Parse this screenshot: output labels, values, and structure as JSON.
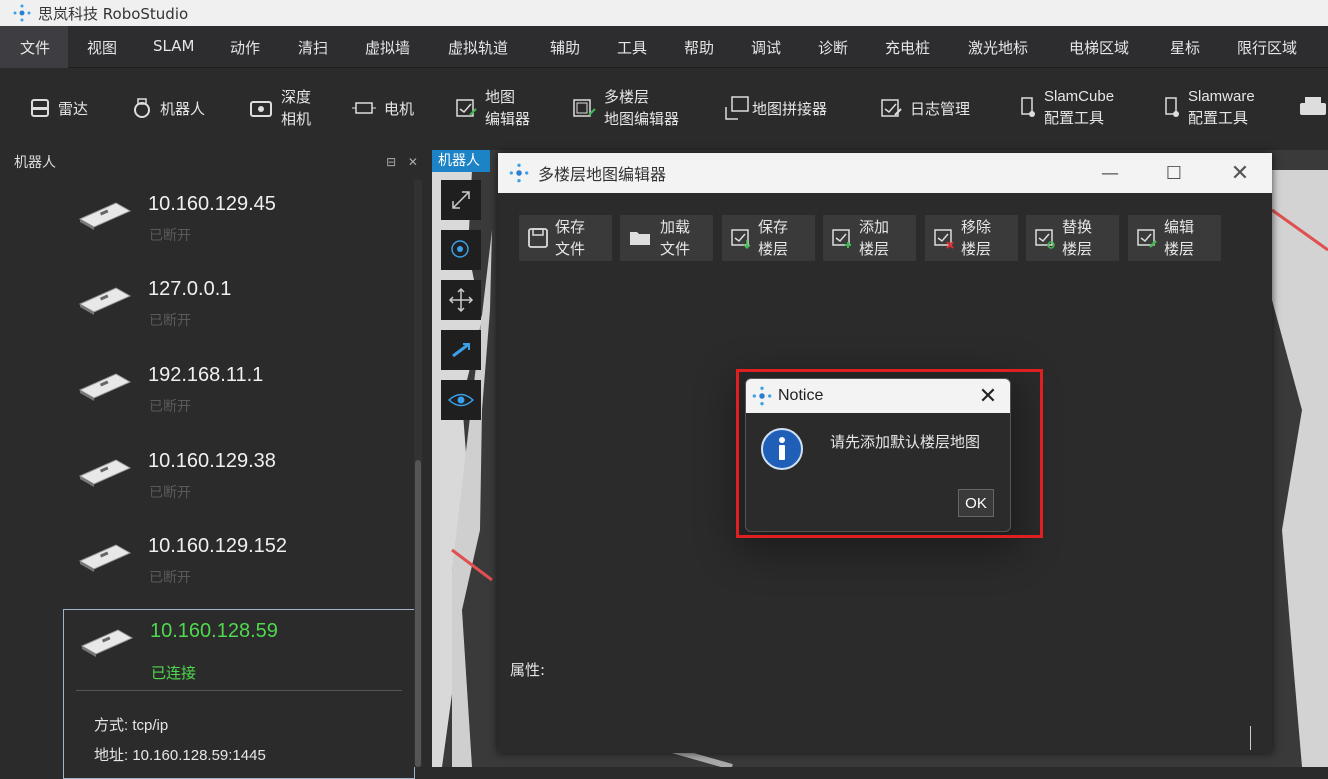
{
  "app": {
    "title": "思岚科技 RoboStudio"
  },
  "menu": [
    "文件",
    "视图",
    "SLAM",
    "动作",
    "清扫",
    "虚拟墙",
    "虚拟轨道",
    "辅助",
    "工具",
    "帮助",
    "调试",
    "诊断",
    "充电桩",
    "激光地标",
    "电梯区域",
    "星标",
    "限行区域"
  ],
  "ribbon": {
    "lidar": "雷达",
    "robot": "机器人",
    "depth_l1": "深度",
    "depth_l2": "相机",
    "motor": "电机",
    "mapedit_l1": "地图",
    "mapedit_l2": "编辑器",
    "multi_l1": "多楼层",
    "multi_l2": "地图编辑器",
    "stitch": "地图拼接器",
    "log": "日志管理",
    "slamcube_l1": "SlamCube",
    "slamcube_l2": "配置工具",
    "slamware_l1": "Slamware",
    "slamware_l2": "配置工具"
  },
  "robot_panel": {
    "title": "机器人",
    "ctrl_icons": "⊟ ✕",
    "robots": [
      {
        "ip": "10.160.129.45",
        "status": "已断开"
      },
      {
        "ip": "127.0.0.1",
        "status": "已断开"
      },
      {
        "ip": "192.168.11.1",
        "status": "已断开"
      },
      {
        "ip": "10.160.129.38",
        "status": "已断开"
      },
      {
        "ip": "10.160.129.152",
        "status": "已断开"
      },
      {
        "ip": "10.160.128.59",
        "status": "已连接"
      }
    ],
    "selected": {
      "mode": "方式: tcp/ip",
      "address": "地址: 10.160.128.59:1445"
    }
  },
  "map": {
    "tab": "机器人"
  },
  "dialog": {
    "title": "多楼层地图编辑器",
    "buttons": [
      {
        "l1": "保存",
        "l2": "文件"
      },
      {
        "l1": "加载",
        "l2": "文件"
      },
      {
        "l1": "保存",
        "l2": "楼层"
      },
      {
        "l1": "添加",
        "l2": "楼层"
      },
      {
        "l1": "移除",
        "l2": "楼层"
      },
      {
        "l1": "替换",
        "l2": "楼层"
      },
      {
        "l1": "编辑",
        "l2": "楼层"
      }
    ],
    "property_label": "属性:"
  },
  "notice": {
    "title": "Notice",
    "message": "请先添加默认楼层地图",
    "ok": "OK"
  },
  "colors": {
    "highlight": "#e02020",
    "connected": "#4ed94e",
    "tab": "#1c84c6"
  }
}
